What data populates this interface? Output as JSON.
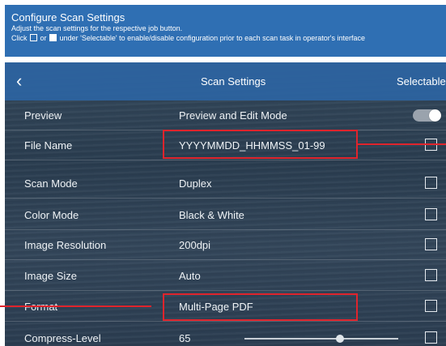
{
  "header": {
    "title": "Configure Scan Settings",
    "line1": "Adjust the scan settings for the respective job button.",
    "line2_prefix": "Click",
    "line2_or": "or",
    "line2_suffix": "under 'Selectable' to enable/disable configuration prior to each scan task in operator's interface"
  },
  "topbar": {
    "back_icon": "chevron-left-icon",
    "back_glyph": "‹",
    "title": "Scan Settings",
    "right_label": "Selectable"
  },
  "rows": [
    {
      "label": "Preview",
      "value": "Preview and Edit Mode",
      "control": "toggle",
      "on": true
    },
    {
      "label": "File Name",
      "value": "YYYYMMDD_HHMMSS_01-99",
      "control": "checkbox",
      "checked": false
    },
    {
      "label": "Scan Mode",
      "value": "Duplex",
      "control": "checkbox",
      "checked": false
    },
    {
      "label": "Color Mode",
      "value": "Black & White",
      "control": "checkbox",
      "checked": false
    },
    {
      "label": "Image Resolution",
      "value": "200dpi",
      "control": "checkbox",
      "checked": false
    },
    {
      "label": "Image Size",
      "value": "Auto",
      "control": "checkbox",
      "checked": false
    },
    {
      "label": "Format",
      "value": "Multi-Page PDF",
      "control": "checkbox",
      "checked": false
    },
    {
      "label": "Compress-Level",
      "value": "65",
      "control": "checkbox",
      "checked": false,
      "slider_fraction": 0.62
    }
  ],
  "colors": {
    "header_bg": "#2f6fb3",
    "highlight": "#e0242c"
  }
}
